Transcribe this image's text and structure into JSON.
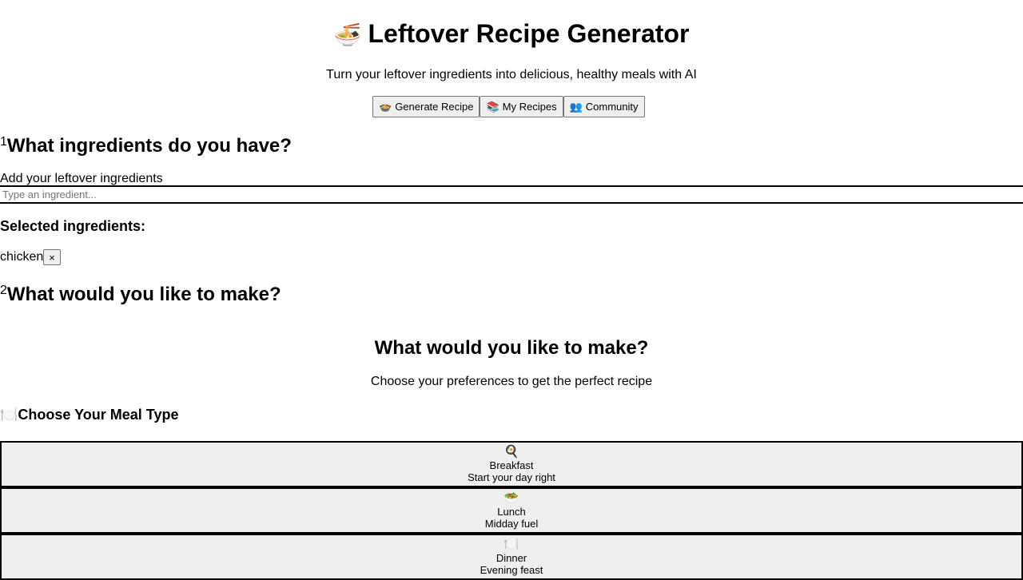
{
  "header": {
    "icon": "🍜",
    "title": "Leftover Recipe Generator",
    "subtitle": "Turn your leftover ingredients into delicious, healthy meals with AI"
  },
  "nav": [
    {
      "icon": "🍲",
      "label": "Generate Recipe"
    },
    {
      "icon": "📚",
      "label": "My Recipes"
    },
    {
      "icon": "👥",
      "label": "Community"
    }
  ],
  "step1": {
    "number": "1",
    "title": "What ingredients do you have?",
    "add_label": "Add your leftover ingredients",
    "input_placeholder": "Type an ingredient...",
    "input_value": "",
    "selected_title": "Selected ingredients:",
    "selected": [
      {
        "name": "chicken",
        "remove_label": "×"
      }
    ]
  },
  "step2": {
    "number": "2",
    "title": "What would you like to make?",
    "section_title": "What would you like to make?",
    "section_subtitle": "Choose your preferences to get the perfect recipe",
    "meal_type_icon": "🍽️",
    "meal_type_title": "Choose Your Meal Type",
    "meals": [
      {
        "icon": "🍳",
        "name": "Breakfast",
        "desc": "Start your day right"
      },
      {
        "icon": "🥗",
        "name": "Lunch",
        "desc": "Midday fuel"
      },
      {
        "icon": "🍽️",
        "name": "Dinner",
        "desc": "Evening feast"
      }
    ]
  }
}
